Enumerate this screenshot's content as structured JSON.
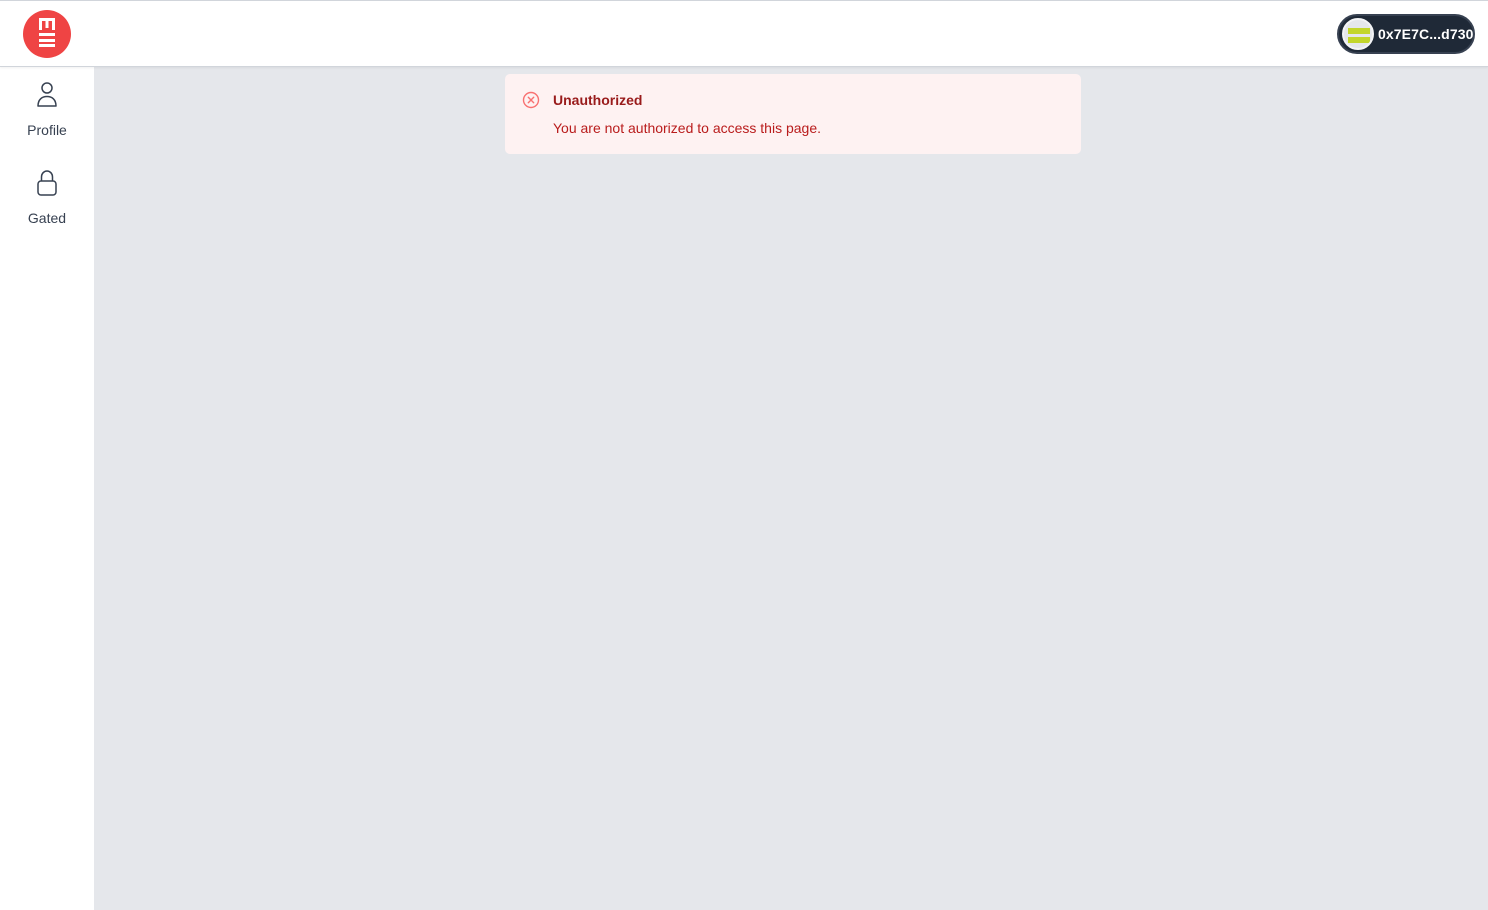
{
  "header": {
    "logo_icon": "brand-logo-icon",
    "wallet": {
      "address": "0x7E7C...d730",
      "avatar_icon": "wallet-avatar-icon"
    }
  },
  "sidebar": {
    "items": [
      {
        "label": "Profile",
        "icon": "user-icon"
      },
      {
        "label": "Gated",
        "icon": "lock-icon"
      }
    ]
  },
  "alert": {
    "title": "Unauthorized",
    "message": "You are not authorized to access this page.",
    "icon": "x-circle-icon"
  },
  "colors": {
    "brand": "#ef4444",
    "main_bg": "#e5e7eb",
    "alert_bg": "#fef2f2",
    "alert_title": "#991b1b",
    "alert_text": "#b91c1c",
    "wallet_bg": "#1f2937",
    "avatar_accent": "#c3d62b"
  }
}
